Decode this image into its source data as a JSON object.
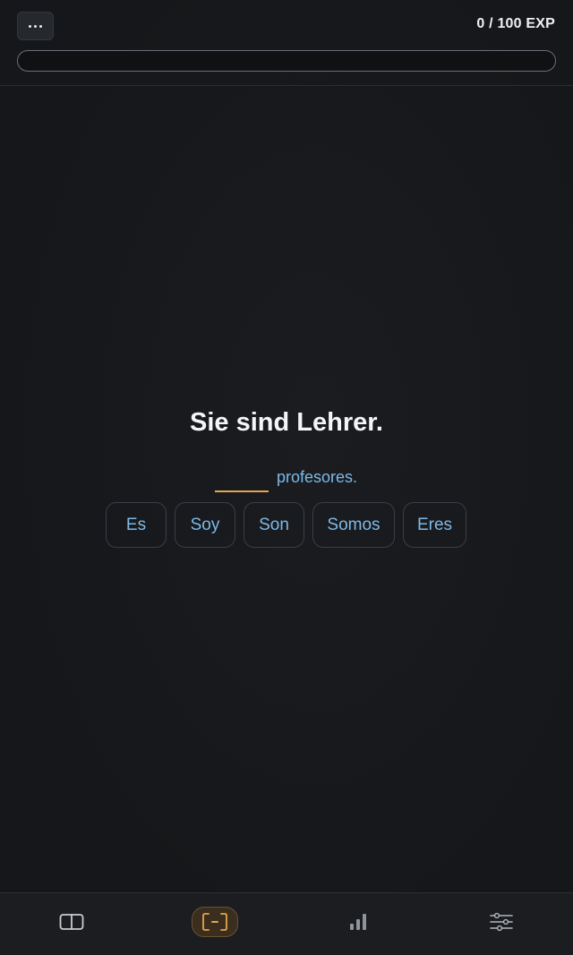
{
  "header": {
    "menu_icon": "more-horizontal-icon",
    "exp_label": "0 / 100 EXP",
    "progress_fraction": 0
  },
  "exercise": {
    "prompt": "Sie sind Lehrer.",
    "sentence_after_blank": "profesores.",
    "options": [
      "Es",
      "Soy",
      "Son",
      "Somos",
      "Eres"
    ]
  },
  "bottom_nav": {
    "items": [
      {
        "icon": "book-icon"
      },
      {
        "icon": "practice-icon",
        "active": true
      },
      {
        "icon": "stats-icon"
      },
      {
        "icon": "settings-sliders-icon"
      }
    ]
  },
  "colors": {
    "background": "#15171a",
    "accent": "#e4a64b",
    "option_text": "#7eb9e6",
    "text": "#f4f5f7"
  }
}
